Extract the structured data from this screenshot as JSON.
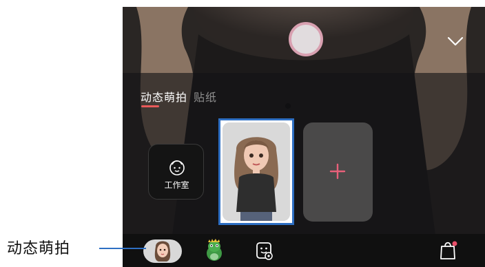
{
  "tabs": [
    {
      "label": "动态萌拍",
      "active": true
    },
    {
      "label": "贴纸",
      "active": false
    }
  ],
  "studio_button": {
    "label": "工作室",
    "icon": "face-outline-icon"
  },
  "add_button": {
    "icon": "plus-icon"
  },
  "bottom_bar": {
    "items": [
      {
        "icon": "avatar-emoji-icon",
        "selected": true
      },
      {
        "icon": "dinosaur-icon"
      },
      {
        "icon": "sticker-settings-icon"
      },
      {
        "icon": "shopping-bag-icon",
        "badge": true
      }
    ]
  },
  "callout": {
    "label": "动态萌拍"
  },
  "colors": {
    "accent_underline": "#e95a5a",
    "highlight_frame": "#2e6fc3",
    "add_plus": "#e8607a",
    "shutter_ring": "#d8a0b0"
  }
}
